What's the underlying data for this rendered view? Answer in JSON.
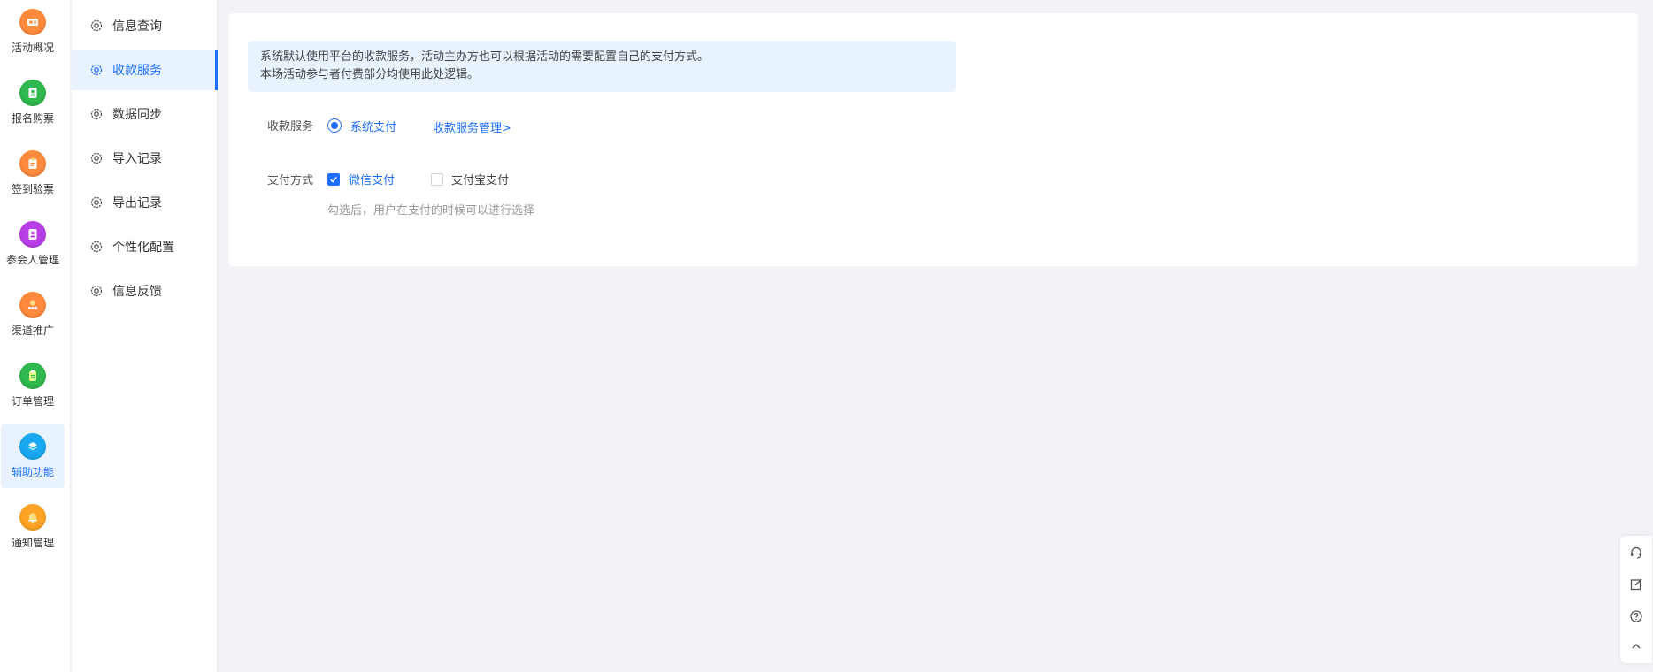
{
  "rail": {
    "items": [
      {
        "label": "活动概况",
        "icon": "activity-overview-icon",
        "color": "#ff8a3d",
        "active": false
      },
      {
        "label": "报名购票",
        "icon": "registration-ticket-icon",
        "color": "#2fb84d",
        "active": false
      },
      {
        "label": "签到验票",
        "icon": "checkin-ticket-icon",
        "color": "#ff8a3d",
        "active": false
      },
      {
        "label": "参会人管理",
        "icon": "attendee-management-icon",
        "color": "#b83ee8",
        "active": false
      },
      {
        "label": "渠道推广",
        "icon": "channel-promotion-icon",
        "color": "#ff8a3d",
        "active": false
      },
      {
        "label": "订单管理",
        "icon": "order-management-icon",
        "color": "#2fb84d",
        "active": false
      },
      {
        "label": "辅助功能",
        "icon": "auxiliary-function-icon",
        "color": "#1aa8f0",
        "active": true
      },
      {
        "label": "通知管理",
        "icon": "notification-management-icon",
        "color": "#ffa424",
        "active": false
      }
    ]
  },
  "submenu": {
    "items": [
      {
        "label": "信息查询",
        "active": false
      },
      {
        "label": "收款服务",
        "active": true
      },
      {
        "label": "数据同步",
        "active": false
      },
      {
        "label": "导入记录",
        "active": false
      },
      {
        "label": "导出记录",
        "active": false
      },
      {
        "label": "个性化配置",
        "active": false
      },
      {
        "label": "信息反馈",
        "active": false
      }
    ]
  },
  "notice": {
    "line1": "系统默认使用平台的收款服务，活动主办方也可以根据活动的需要配置自己的支付方式。",
    "line2": "本场活动参与者付费部分均使用此处逻辑。"
  },
  "payment_service": {
    "label": "收款服务",
    "option": "系统支付",
    "selected": true,
    "manage_link": "收款服务管理>"
  },
  "payment_method": {
    "label": "支付方式",
    "options": [
      {
        "label": "微信支付",
        "checked": true
      },
      {
        "label": "支付宝支付",
        "checked": false
      }
    ],
    "hint": "勾选后，用户在支付的时候可以进行选择"
  },
  "floatbar": {
    "buttons": [
      "customer-service-icon",
      "edit-icon",
      "help-icon",
      "back-to-top-icon"
    ]
  },
  "colors": {
    "accent": "#1e6fff",
    "active_bg": "#e8f3ff"
  }
}
